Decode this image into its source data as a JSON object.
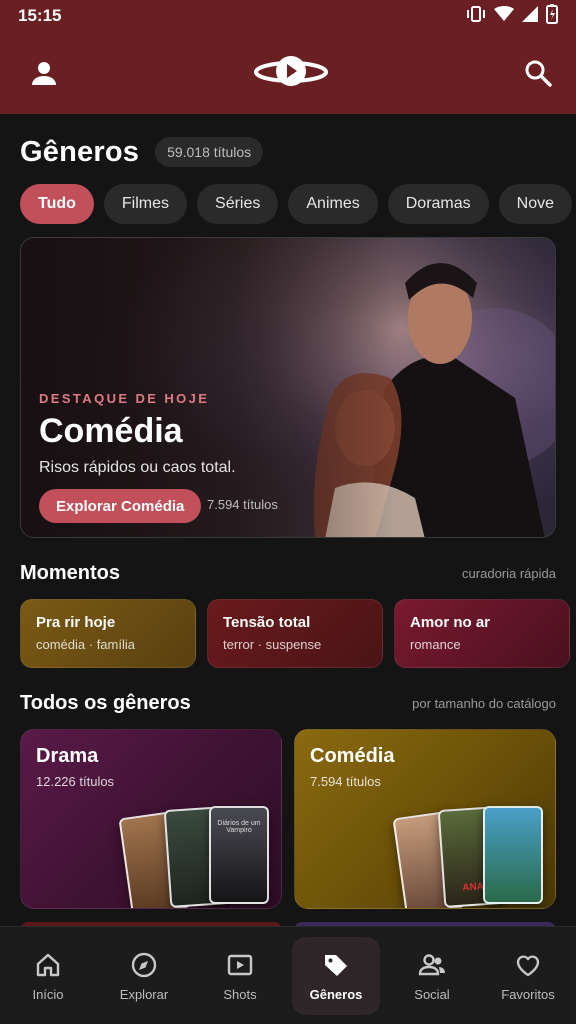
{
  "status": {
    "time": "15:15"
  },
  "colors": {
    "appbar": "#6a1f22",
    "accent": "#c2505a",
    "background": "#141414"
  },
  "header": {
    "title": "Gêneros",
    "count": "59.018 títulos"
  },
  "chips": [
    {
      "label": "Tudo",
      "active": true
    },
    {
      "label": "Filmes"
    },
    {
      "label": "Séries"
    },
    {
      "label": "Animes"
    },
    {
      "label": "Doramas"
    },
    {
      "label": "Nove"
    }
  ],
  "hero": {
    "kicker": "DESTAQUE DE HOJE",
    "title": "Comédia",
    "subtitle": "Risos rápidos ou caos total.",
    "cta": "Explorar Comédia",
    "count": "7.594 títulos"
  },
  "moments_section": {
    "title": "Momentos",
    "note": "curadoria rápida",
    "items": [
      {
        "title": "Pra rir hoje",
        "sub": "comédia · família"
      },
      {
        "title": "Tensão total",
        "sub": "terror · suspense"
      },
      {
        "title": "Amor no ar",
        "sub": "romance"
      }
    ]
  },
  "genres_section": {
    "title": "Todos os gêneros",
    "note": "por tamanho do catálogo",
    "cards": [
      {
        "title": "Drama",
        "count": "12.226 títulos",
        "posters": [
          "",
          "",
          "Diários de um Vampiro"
        ]
      },
      {
        "title": "Comédia",
        "count": "7.594 títulos",
        "posters": [
          "",
          "ANA",
          ""
        ]
      }
    ]
  },
  "nav": [
    {
      "label": "Início",
      "icon": "home-icon"
    },
    {
      "label": "Explorar",
      "icon": "compass-icon"
    },
    {
      "label": "Shots",
      "icon": "play-square-icon"
    },
    {
      "label": "Gêneros",
      "icon": "tag-icon",
      "active": true
    },
    {
      "label": "Social",
      "icon": "people-icon"
    },
    {
      "label": "Favoritos",
      "icon": "heart-icon"
    }
  ]
}
